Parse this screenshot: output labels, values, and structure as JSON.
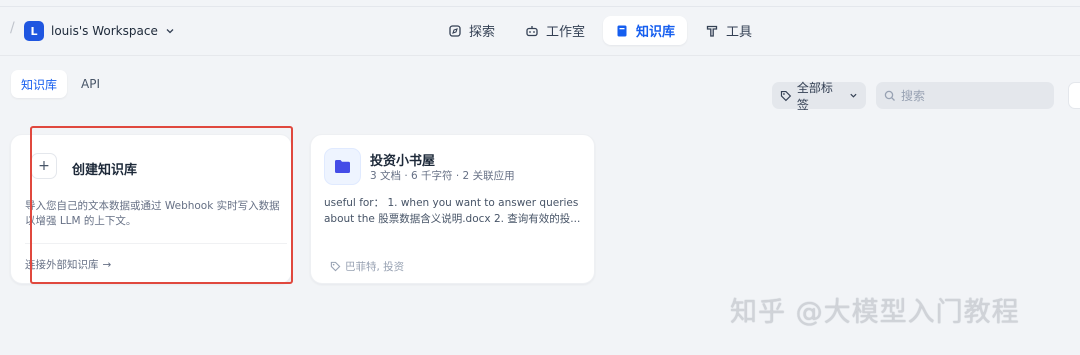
{
  "header": {
    "separator": "/",
    "workspace_initial": "L",
    "workspace_name": "louis's Workspace",
    "nav": [
      {
        "label": "探索",
        "icon": "compass-icon"
      },
      {
        "label": "工作室",
        "icon": "robot-icon"
      },
      {
        "label": "知识库",
        "icon": "book-icon",
        "active": true
      },
      {
        "label": "工具",
        "icon": "tool-icon"
      }
    ]
  },
  "tabs": [
    {
      "label": "知识库",
      "active": true
    },
    {
      "label": "API",
      "active": false
    }
  ],
  "filters": {
    "tag_label": "全部标签",
    "search_placeholder": "搜索"
  },
  "create_card": {
    "plus": "+",
    "title": "创建知识库",
    "description": "导入您自己的文本数据或通过 Webhook 实时写入数据以增强 LLM 的上下文。",
    "connect_link": "连接外部知识库",
    "arrow": "→"
  },
  "knowledge_bases": [
    {
      "title": "投资小书屋",
      "meta": "3 文档 · 6 千字符 · 2 关联应用",
      "description": "useful for： 1. when you want to answer queries about the 股票数据含义说明.docx 2. 查询有效的投...",
      "tags": "巴菲特, 投资"
    }
  ],
  "watermark": "知乎 @大模型入门教程",
  "colors": {
    "accent": "#155eef",
    "workspace_avatar": "#1f56e0",
    "highlight_box": "#e0483e"
  }
}
